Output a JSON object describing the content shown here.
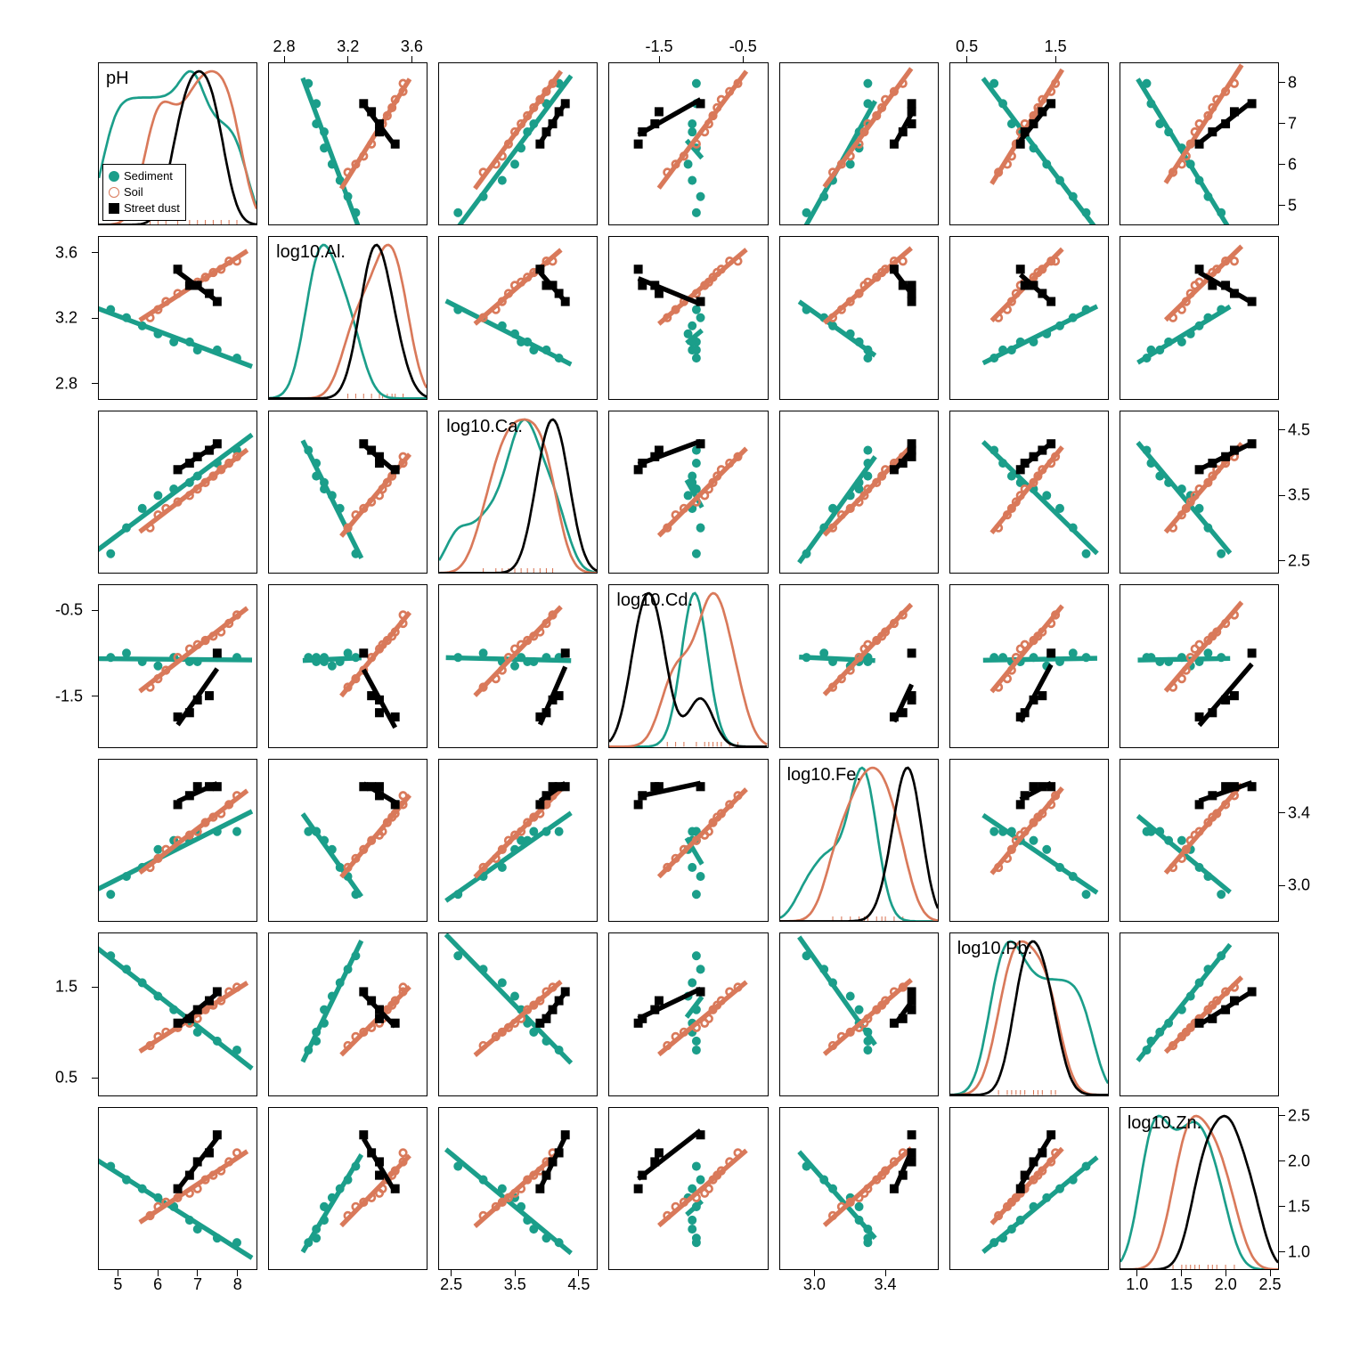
{
  "chart_data": {
    "type": "scatter",
    "description": "7×7 scatterplot matrix (pairs plot) of soil/sediment/street-dust geochemistry variables. Diagonal cells show density curves per group; off-diagonal cells show pairwise scatter with per-group linear fit lines.",
    "variables": [
      "pH",
      "log10.Al.",
      "log10.Ca.",
      "log10.Cd.",
      "log10.Fe.",
      "log10.Pb.",
      "log10.Zn."
    ],
    "groups": [
      {
        "name": "Sediment",
        "marker": "filled-circle",
        "color": "#1b9e8a"
      },
      {
        "name": "Soil",
        "marker": "open-circle",
        "color": "#d9795a"
      },
      {
        "name": "Street dust",
        "marker": "filled-square",
        "color": "#000000"
      }
    ],
    "axis_ranges": {
      "pH": {
        "min": 4.5,
        "max": 8.5,
        "ticks": [
          5,
          6,
          7,
          8
        ]
      },
      "log10.Al.": {
        "min": 2.7,
        "max": 3.7,
        "ticks": [
          2.8,
          3.2,
          3.6
        ]
      },
      "log10.Ca.": {
        "min": 2.3,
        "max": 4.8,
        "ticks": [
          2.5,
          3.5,
          4.5
        ]
      },
      "log10.Cd.": {
        "min": -2.1,
        "max": -0.2,
        "ticks": [
          -1.5,
          -0.5
        ]
      },
      "log10.Fe.": {
        "min": 2.8,
        "max": 3.7,
        "ticks": [
          3.0,
          3.4
        ]
      },
      "log10.Pb.": {
        "min": 0.3,
        "max": 2.1,
        "ticks": [
          0.5,
          1.5
        ]
      },
      "log10.Zn.": {
        "min": 0.8,
        "max": 2.6,
        "ticks": [
          1.0,
          1.5,
          2.0,
          2.5
        ]
      }
    },
    "axis_placement": {
      "top": {
        "col": 1,
        "var": "log10.Al.",
        "ticks": [
          2.8,
          3.2,
          3.6
        ]
      },
      "top2": {
        "col": 3,
        "var": "log10.Cd.",
        "ticks": [
          -1.5,
          -0.5
        ]
      },
      "top3": {
        "col": 5,
        "var": "log10.Pb.",
        "ticks": [
          0.5,
          1.5
        ]
      },
      "bottom": {
        "col": 0,
        "var": "pH",
        "ticks": [
          5,
          6,
          7,
          8
        ]
      },
      "bottom2": {
        "col": 2,
        "var": "log10.Ca.",
        "ticks": [
          2.5,
          3.5,
          4.5
        ]
      },
      "bottom3": {
        "col": 4,
        "var": "log10.Fe.",
        "ticks": [
          3.0,
          3.4
        ]
      },
      "bottom4": {
        "col": 6,
        "var": "log10.Zn.",
        "ticks": [
          1.0,
          1.5,
          2.0,
          2.5
        ]
      },
      "left": {
        "row": 1,
        "var": "log10.Al.",
        "ticks": [
          2.8,
          3.2,
          3.6
        ]
      },
      "left2": {
        "row": 3,
        "var": "log10.Cd.",
        "ticks": [
          -1.5,
          -0.5
        ]
      },
      "left3": {
        "row": 5,
        "var": "log10.Pb.",
        "ticks": [
          0.5,
          1.5
        ]
      },
      "right": {
        "row": 0,
        "var": "pH",
        "ticks": [
          5,
          6,
          7,
          8
        ]
      },
      "right2": {
        "row": 2,
        "var": "log10.Ca.",
        "ticks": [
          2.5,
          3.5,
          4.5
        ]
      },
      "right3": {
        "row": 4,
        "var": "log10.Fe.",
        "ticks": [
          3.0,
          3.4
        ]
      },
      "right4": {
        "row": 6,
        "var": "log10.Zn.",
        "ticks": [
          1.0,
          1.5,
          2.0,
          2.5
        ]
      }
    },
    "approx_points": {
      "note": "Approximate sample values read from the scatterplots (per group). Each point is [pH, log10.Al., log10.Ca., log10.Cd., log10.Fe., log10.Pb., log10.Zn.]",
      "Sediment": [
        [
          4.8,
          3.25,
          2.6,
          -1.05,
          2.95,
          1.85,
          1.95
        ],
        [
          5.2,
          3.2,
          3.0,
          -1.0,
          3.05,
          1.7,
          1.8
        ],
        [
          5.6,
          3.15,
          3.3,
          -1.1,
          3.1,
          1.55,
          1.7
        ],
        [
          6.0,
          3.1,
          3.5,
          -1.15,
          3.2,
          1.4,
          1.6
        ],
        [
          6.4,
          3.05,
          3.6,
          -1.05,
          3.25,
          1.25,
          1.5
        ],
        [
          6.8,
          3.05,
          3.7,
          -1.1,
          3.25,
          1.1,
          1.35
        ],
        [
          7.0,
          3.0,
          3.8,
          -1.1,
          3.3,
          1.0,
          1.25
        ],
        [
          7.5,
          3.0,
          4.0,
          -1.05,
          3.3,
          0.9,
          1.15
        ],
        [
          8.0,
          2.95,
          4.2,
          -1.05,
          3.3,
          0.8,
          1.1
        ]
      ],
      "Soil": [
        [
          5.8,
          3.2,
          3.0,
          -1.4,
          3.1,
          0.85,
          1.4
        ],
        [
          6.0,
          3.25,
          3.2,
          -1.3,
          3.15,
          0.95,
          1.5
        ],
        [
          6.2,
          3.3,
          3.3,
          -1.2,
          3.2,
          1.0,
          1.55
        ],
        [
          6.5,
          3.35,
          3.4,
          -1.05,
          3.25,
          1.05,
          1.6
        ],
        [
          6.8,
          3.4,
          3.5,
          -0.95,
          3.28,
          1.1,
          1.65
        ],
        [
          7.0,
          3.42,
          3.6,
          -0.9,
          3.3,
          1.15,
          1.7
        ],
        [
          7.2,
          3.45,
          3.7,
          -0.85,
          3.35,
          1.25,
          1.8
        ],
        [
          7.4,
          3.48,
          3.8,
          -0.8,
          3.38,
          1.3,
          1.85
        ],
        [
          7.6,
          3.5,
          3.9,
          -0.75,
          3.4,
          1.35,
          1.9
        ],
        [
          7.8,
          3.55,
          4.0,
          -0.65,
          3.45,
          1.45,
          2.0
        ],
        [
          8.0,
          3.55,
          4.1,
          -0.55,
          3.5,
          1.5,
          2.1
        ]
      ],
      "Street dust": [
        [
          6.5,
          3.5,
          3.9,
          -1.75,
          3.45,
          1.1,
          1.7
        ],
        [
          6.8,
          3.4,
          4.0,
          -1.7,
          3.5,
          1.15,
          1.85
        ],
        [
          7.0,
          3.4,
          4.1,
          -1.55,
          3.55,
          1.25,
          2.0
        ],
        [
          7.3,
          3.35,
          4.2,
          -1.5,
          3.55,
          1.35,
          2.1
        ],
        [
          7.5,
          3.3,
          4.3,
          -1.0,
          3.55,
          1.45,
          2.3
        ]
      ]
    },
    "fit_lines_note": "Each off-diagonal panel shows three straight-line fits (one per group) through that group's points. Slopes visually: Soil mostly positive; Sediment often negative vs pH and positive elsewhere; Street-dust short steep segments."
  },
  "labels": {
    "vars": [
      "pH",
      "log10.Al.",
      "log10.Ca.",
      "log10.Cd.",
      "log10.Fe.",
      "log10.Pb.",
      "log10.Zn."
    ],
    "legend": {
      "sed": "Sediment",
      "soil": "Soil",
      "dust": "Street dust"
    }
  },
  "ticks": {
    "top": {
      "1": [
        "2.8",
        "3.2",
        "3.6"
      ],
      "3": [
        "-1.5",
        "-0.5"
      ],
      "5": [
        "0.5",
        "1.5"
      ]
    },
    "bottom": {
      "0": [
        "5",
        "6",
        "7",
        "8"
      ],
      "2": [
        "2.5",
        "3.5",
        "4.5"
      ],
      "4": [
        "3.0",
        "3.4"
      ],
      "6": [
        "1.0",
        "1.5",
        "2.0",
        "2.5"
      ]
    },
    "left": {
      "1": [
        "2.8",
        "3.2",
        "3.6"
      ],
      "3": [
        "-1.5",
        "-0.5"
      ],
      "5": [
        "0.5",
        "1.5"
      ]
    },
    "right": {
      "0": [
        "5",
        "6",
        "7",
        "8"
      ],
      "2": [
        "2.5",
        "3.5",
        "4.5"
      ],
      "4": [
        "3.0",
        "3.4"
      ],
      "6": [
        "1.0",
        "1.5",
        "2.0",
        "2.5"
      ]
    }
  }
}
